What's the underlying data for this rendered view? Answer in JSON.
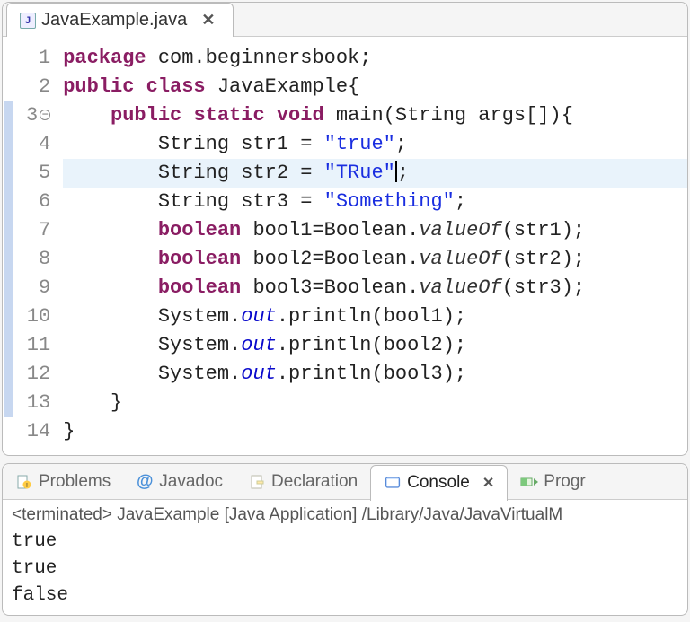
{
  "editor": {
    "file_tab": {
      "icon_letter": "J",
      "title": "JavaExample.java",
      "close_glyph": "✕"
    },
    "line_numbers": [
      "1",
      "2",
      "3",
      "4",
      "5",
      "6",
      "7",
      "8",
      "9",
      "10",
      "11",
      "12",
      "13",
      "14"
    ],
    "fold_line": 3,
    "highlighted_line": 5,
    "code": {
      "l1_kw": "package",
      "l1_rest": " com.beginnersbook;",
      "l2_kw1": "public",
      "l2_kw2": "class",
      "l2_rest": " JavaExample{",
      "l3_kw1": "public",
      "l3_kw2": "static",
      "l3_kw3": "void",
      "l3_rest": " main(String args[]){",
      "l4_pre": "        String str1 = ",
      "l4_str": "\"true\"",
      "l4_post": ";",
      "l5_pre": "        String str2 = ",
      "l5_str": "\"TRue\"",
      "l5_post": ";",
      "l6_pre": "        String str3 = ",
      "l6_str": "\"Something\"",
      "l6_post": ";",
      "l7_kw": "boolean",
      "l7_mid": " bool1=Boolean.",
      "l7_it": "valueOf",
      "l7_post": "(str1);",
      "l8_kw": "boolean",
      "l8_mid": " bool2=Boolean.",
      "l8_it": "valueOf",
      "l8_post": "(str2);",
      "l9_kw": "boolean",
      "l9_mid": " bool3=Boolean.",
      "l9_it": "valueOf",
      "l9_post": "(str3);",
      "l10_pre": "        System.",
      "l10_out": "out",
      "l10_post": ".println(bool1);",
      "l11_pre": "        System.",
      "l11_out": "out",
      "l11_post": ".println(bool2);",
      "l12_pre": "        System.",
      "l12_out": "out",
      "l12_post": ".println(bool3);",
      "l13": "    }",
      "l14": "}"
    }
  },
  "bottom": {
    "tabs": {
      "problems": "Problems",
      "javadoc": "Javadoc",
      "declaration": "Declaration",
      "console": "Console",
      "progress": "Progr"
    },
    "console_close_glyph": "✕",
    "status_line": "<terminated> JavaExample [Java Application] /Library/Java/JavaVirtualM",
    "output": [
      "true",
      "true",
      "false"
    ]
  },
  "icons": {
    "problems_glyph": "⚠",
    "javadoc_glyph": "@",
    "declaration_glyph": "📄",
    "console_glyph": "🖥",
    "progress_glyph": "▶"
  }
}
